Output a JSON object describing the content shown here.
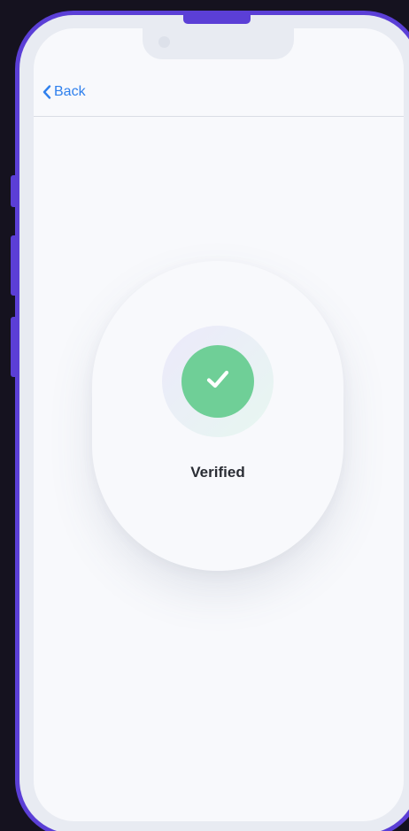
{
  "nav": {
    "back_label": "Back"
  },
  "verification": {
    "status_text": "Verified",
    "icon": "checkmark-icon"
  },
  "colors": {
    "background": "#15121f",
    "frame": "#5b3fd6",
    "screen": "#f8f9fc",
    "link": "#2f80ed",
    "success": "#6fcf97",
    "text": "#2a2d34"
  }
}
